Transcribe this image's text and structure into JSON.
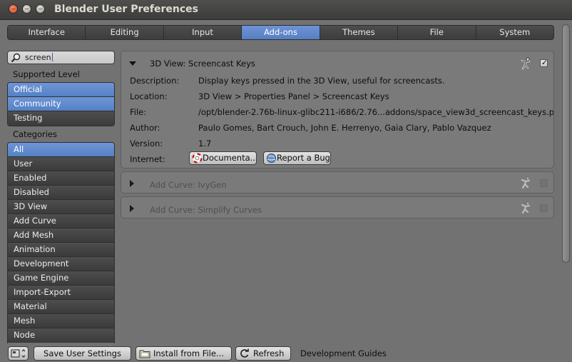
{
  "window": {
    "title": "Blender User Preferences"
  },
  "tabs": [
    {
      "label": "Interface",
      "active": false
    },
    {
      "label": "Editing",
      "active": false
    },
    {
      "label": "Input",
      "active": false
    },
    {
      "label": "Add-ons",
      "active": true
    },
    {
      "label": "Themes",
      "active": false
    },
    {
      "label": "File",
      "active": false
    },
    {
      "label": "System",
      "active": false
    }
  ],
  "search": {
    "value": "screen",
    "icon": "search-icon"
  },
  "supported_level": {
    "label": "Supported Level",
    "items": [
      {
        "label": "Official",
        "selected": true
      },
      {
        "label": "Community",
        "selected": true
      },
      {
        "label": "Testing",
        "selected": false
      }
    ]
  },
  "categories": {
    "label": "Categories",
    "items": [
      {
        "label": "All",
        "selected": true
      },
      {
        "label": "User",
        "selected": false
      },
      {
        "label": "Enabled",
        "selected": false
      },
      {
        "label": "Disabled",
        "selected": false
      },
      {
        "label": "3D View",
        "selected": false
      },
      {
        "label": "Add Curve",
        "selected": false
      },
      {
        "label": "Add Mesh",
        "selected": false
      },
      {
        "label": "Animation",
        "selected": false
      },
      {
        "label": "Development",
        "selected": false
      },
      {
        "label": "Game Engine",
        "selected": false
      },
      {
        "label": "Import-Export",
        "selected": false
      },
      {
        "label": "Material",
        "selected": false
      },
      {
        "label": "Mesh",
        "selected": false
      },
      {
        "label": "Node",
        "selected": false
      }
    ]
  },
  "addons": [
    {
      "name": "3D View: Screencast Keys",
      "expanded": true,
      "enabled": true,
      "details": {
        "description_key": "Description:",
        "description": "Display keys pressed in the 3D View, useful for screencasts.",
        "location_key": "Location:",
        "location": "3D View > Properties Panel > Screencast Keys",
        "file_key": "File:",
        "file": "/opt/blender-2.76b-linux-glibc211-i686/2.76...addons/space_view3d_screencast_keys.p",
        "author_key": "Author:",
        "author": "Paulo Gomes, Bart Crouch, John E. Herrenyo, Gaia Clary, Pablo Vazquez",
        "version_key": "Version:",
        "version": "1.7",
        "internet_key": "Internet:",
        "documentation_button": "Documenta...",
        "report_bug_button": "Report a Bug"
      }
    },
    {
      "name": "Add Curve: IvyGen",
      "expanded": false,
      "enabled": false
    },
    {
      "name": "Add Curve: Simplify Curves",
      "expanded": false,
      "enabled": false
    }
  ],
  "bottom_bar": {
    "save_button": "Save User Settings",
    "install_button": "Install from File...",
    "refresh_button": "Refresh",
    "guides_link": "Development Guides"
  },
  "colors": {
    "accent_blue": "#5f8ad0",
    "panel_bg": "#727272"
  }
}
